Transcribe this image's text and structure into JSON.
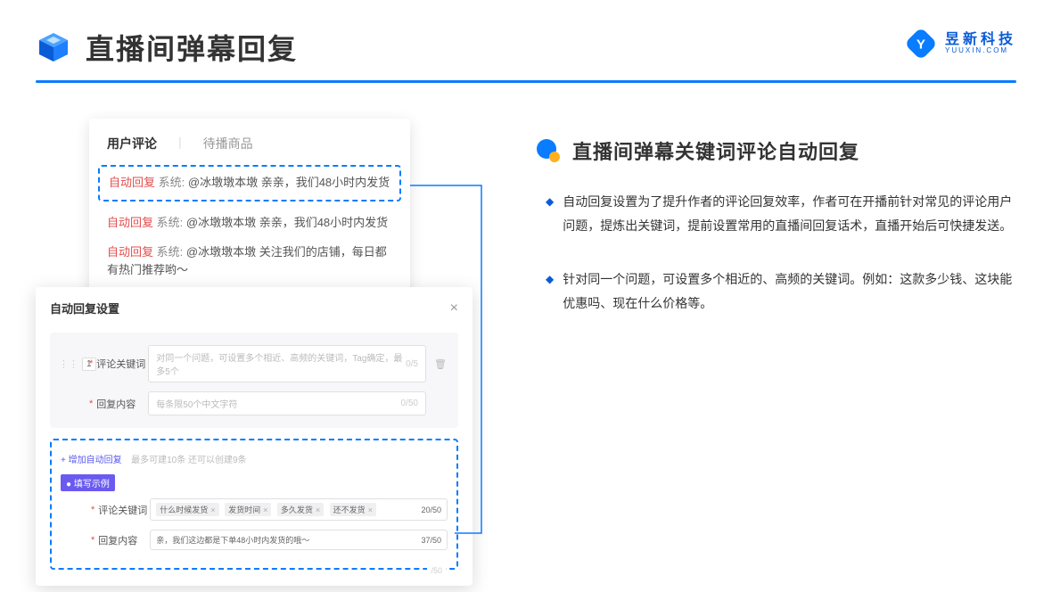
{
  "header": {
    "title": "直播间弹幕回复",
    "brand_name": "昱新科技",
    "brand_sub": "YUUXIN.COM"
  },
  "comments_panel": {
    "tab_active": "用户评论",
    "tab_other": "待播商品",
    "rows": [
      {
        "tag_auto": "自动回复",
        "tag_sys": "系统:",
        "text": "@冰墩墩本墩 亲亲，我们48小时内发货"
      },
      {
        "tag_auto": "自动回复",
        "tag_sys": "系统:",
        "text": "@冰墩墩本墩 亲亲，我们48小时内发货"
      },
      {
        "tag_auto": "自动回复",
        "tag_sys": "系统:",
        "text": "@冰墩墩本墩 关注我们的店铺，每日都有热门推荐哟～"
      }
    ]
  },
  "settings_panel": {
    "title": "自动回复设置",
    "index": "1",
    "label_keyword": "评论关键词",
    "placeholder_keyword": "对同一个问题，可设置多个相近、高频的关键词，Tag确定，最多5个",
    "count_keyword": "0/5",
    "label_content": "回复内容",
    "placeholder_content": "每条限50个中文字符",
    "count_content": "0/50",
    "add_link": "+ 增加自动回复",
    "add_hint": "最多可建10条 还可以创建9条",
    "example_badge": "● 填写示例",
    "example_keyword_label": "评论关键词",
    "example_tags": [
      "什么时候发货",
      "发货时间",
      "多久发货",
      "还不发货"
    ],
    "example_kw_count": "20/50",
    "example_content_label": "回复内容",
    "example_content_value": "亲，我们这边都是下单48小时内发货的哦～",
    "example_content_count": "37/50",
    "remain": "/50"
  },
  "right": {
    "section_title": "直播间弹幕关键词评论自动回复",
    "bullets": [
      "自动回复设置为了提升作者的评论回复效率，作者可在开播前针对常见的评论用户问题，提炼出关键词，提前设置常用的直播间回复话术，直播开始后可快捷发送。",
      "针对同一个问题，可设置多个相近的、高频的关键词。例如：这款多少钱、这块能优惠吗、现在什么价格等。"
    ]
  }
}
